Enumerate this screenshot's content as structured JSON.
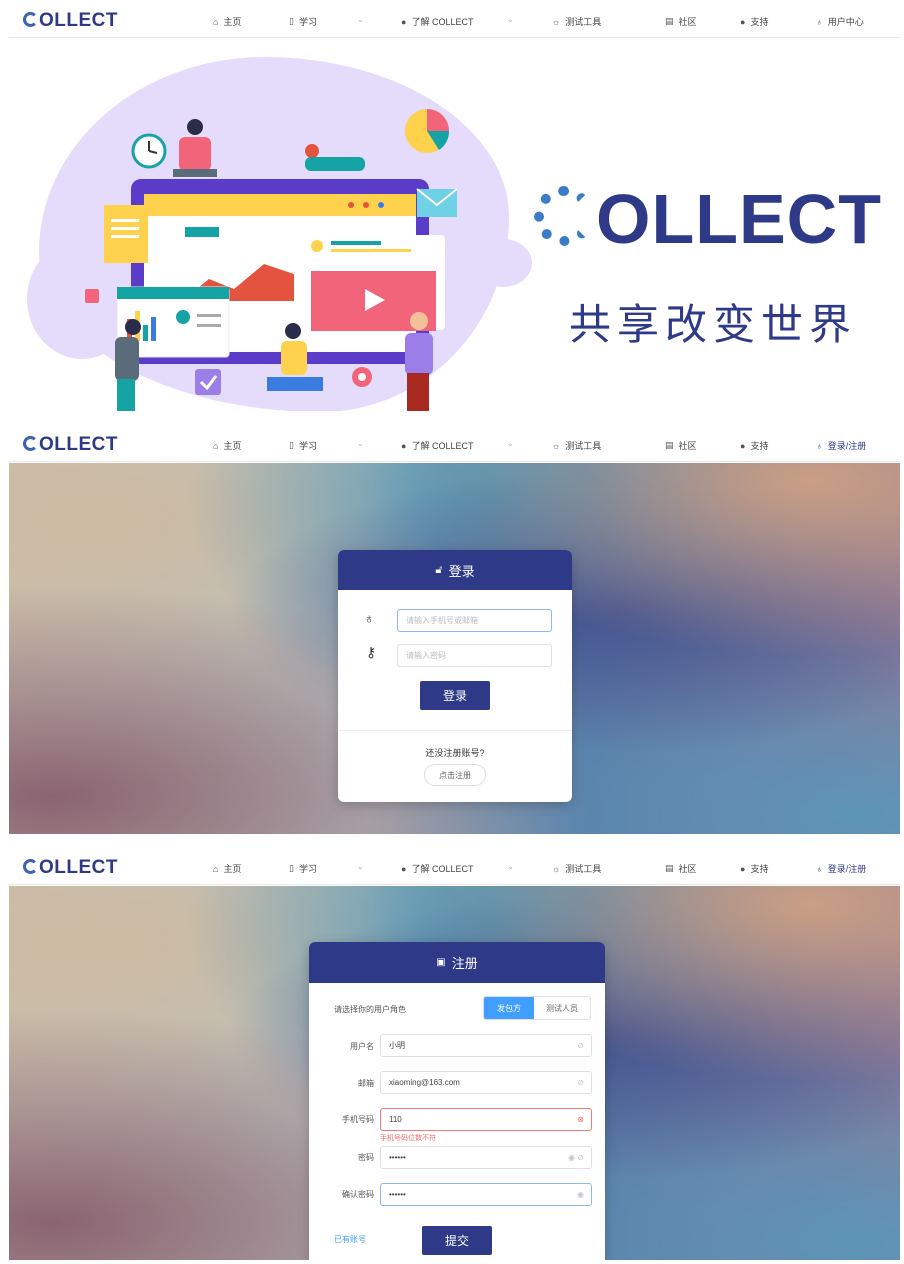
{
  "nav": {
    "logo": "OLLECT",
    "items": [
      {
        "label": "主页",
        "icon": "home-icon"
      },
      {
        "label": "学习",
        "icon": "book-icon"
      },
      {
        "label": "了解 COLLECT",
        "icon": "help-icon"
      },
      {
        "label": "测试工具",
        "icon": "gear-icon"
      },
      {
        "label": "社区",
        "icon": "building-icon"
      },
      {
        "label": "支持",
        "icon": "bulb-icon"
      }
    ],
    "user_center": "用户中心",
    "login_register": "登录/注册"
  },
  "hero": {
    "brand": "OLLECT",
    "slogan": "共享改变世界"
  },
  "login": {
    "title": "登录",
    "username_placeholder": "请输入手机号或邮箱",
    "password_placeholder": "请输入密码",
    "submit": "登录",
    "no_account": "还没注册账号?",
    "register_button": "点击注册"
  },
  "register": {
    "title": "注册",
    "role_prompt": "请选择你的用户角色",
    "roles": [
      "发包方",
      "测试人员"
    ],
    "selected_role": "发包方",
    "fields": [
      {
        "label": "用户名",
        "value": "小明"
      },
      {
        "label": "邮箱",
        "value": "xiaoming@163.com"
      },
      {
        "label": "手机号码",
        "value": "110",
        "error": "手机号码位数不符"
      },
      {
        "label": "密码",
        "value": "••••••"
      },
      {
        "label": "确认密码",
        "value": "••••••"
      }
    ],
    "have_account": "已有账号",
    "submit": "提交"
  },
  "colors": {
    "brand": "#2e3a87",
    "accent": "#409eff",
    "error": "#f56c6c"
  }
}
